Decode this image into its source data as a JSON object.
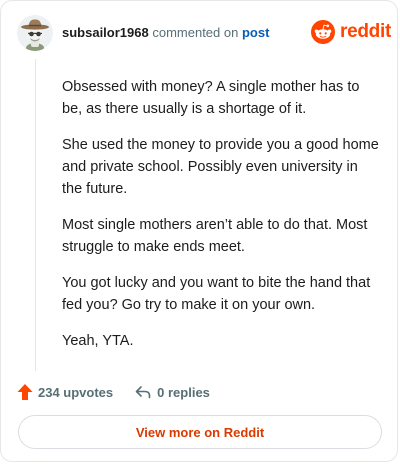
{
  "comment": {
    "username": "subsailor1968",
    "commented_text": "commented on",
    "post_link": "post",
    "paragraphs": [
      "Obsessed with money? A single mother has to be, as there usually is a shortage of it.",
      "She used the money to provide you a good home and private school. Possibly even university in the future.",
      "Most single mothers aren’t able to do that. Most struggle to make ends meet.",
      "You got lucky and you want to bite the hand that fed you? Go try to make it on your own.",
      "Yeah, YTA."
    ],
    "upvotes": "234 upvotes",
    "replies": "0 replies"
  },
  "brand": {
    "wordmark": "reddit",
    "color": "#ff4500"
  },
  "footer": {
    "view_more": "View more on Reddit"
  },
  "icons": {
    "avatar": "avatar-snoo-cowboy-icon",
    "logo": "reddit-snoo-icon",
    "upvote": "upvote-arrow-icon",
    "reply": "reply-arrow-icon"
  },
  "colors": {
    "accent": "#ff4500",
    "link": "#0a5db7",
    "view_more": "#d93a00",
    "meta": "#576f76"
  }
}
